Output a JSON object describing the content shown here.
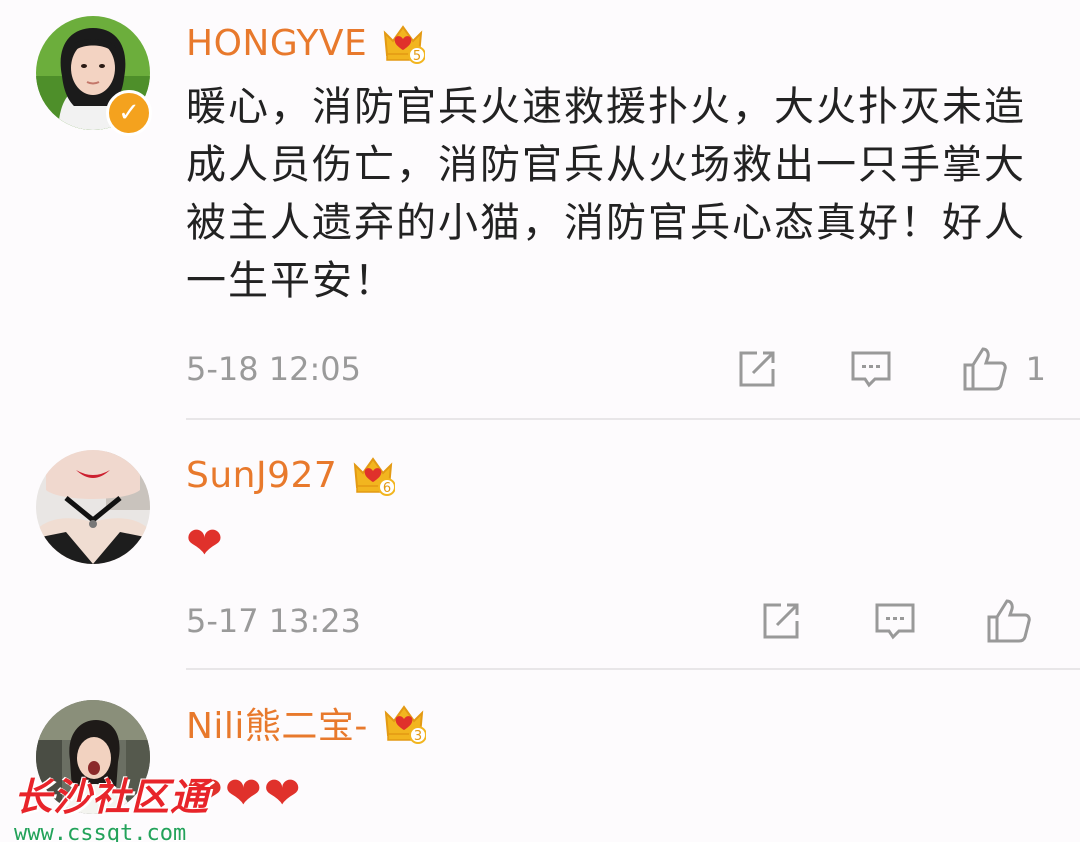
{
  "comments": [
    {
      "username": "HONGYVE",
      "vip_level": "5",
      "verified": true,
      "text": "暖心，消防官兵火速救援扑火，大火扑灭未造成人员伤亡，消防官兵从火场救出一只手掌大被主人遗弃的小猫，消防官兵心态真好！好人一生平安！",
      "time": "5-18 12:05",
      "like_count": "1"
    },
    {
      "username": "SunJ927",
      "vip_level": "6",
      "verified": false,
      "text": "❤",
      "time": "5-17 13:23",
      "like_count": ""
    },
    {
      "username": "Nili熊二宝-",
      "vip_level": "3",
      "verified": false,
      "text": "❤❤❤",
      "time": "",
      "like_count": ""
    }
  ],
  "icons": {
    "repost": "repost-icon",
    "reply": "comment-icon",
    "like": "thumbs-up-icon",
    "vip": "crown-badge-icon",
    "verified": "verified-v-icon"
  },
  "colors": {
    "username": "#e8792c",
    "text": "#222222",
    "meta": "#9a9a9a",
    "heart": "#e0312b",
    "verified": "#f4a21e",
    "crown": "#f2b51f"
  },
  "watermark": {
    "title": "长沙社区通",
    "url": "www.cssqt.com"
  }
}
